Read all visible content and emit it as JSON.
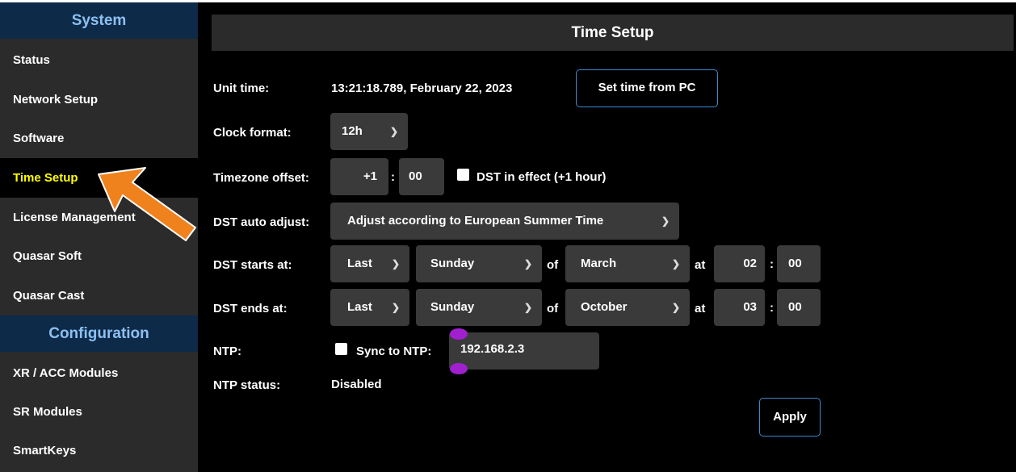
{
  "sidebar": {
    "section_system": "System",
    "section_configuration": "Configuration",
    "items": [
      {
        "label": "Status"
      },
      {
        "label": "Network Setup"
      },
      {
        "label": "Software"
      },
      {
        "label": "Time Setup"
      },
      {
        "label": "License Management"
      },
      {
        "label": "Quasar Soft"
      },
      {
        "label": "Quasar Cast"
      },
      {
        "label": "XR / ACC Modules"
      },
      {
        "label": "SR Modules"
      },
      {
        "label": "SmartKeys"
      }
    ],
    "active_item": "Time Setup"
  },
  "page": {
    "title": "Time Setup"
  },
  "form": {
    "unit_time": {
      "label": "Unit time:",
      "value": "13:21:18.789, February 22, 2023",
      "button": "Set time from PC"
    },
    "clock_format": {
      "label": "Clock format:",
      "value": "12h"
    },
    "timezone": {
      "label": "Timezone offset:",
      "hours": "+1",
      "minutes": "00",
      "dst_checkbox_label": "DST in effect (+1 hour)",
      "dst_checked": false
    },
    "dst_auto": {
      "label": "DST auto adjust:",
      "value": "Adjust according to European Summer Time"
    },
    "dst_start": {
      "label": "DST starts at:",
      "week": "Last",
      "day": "Sunday",
      "of": "of",
      "month": "March",
      "at": "at",
      "hour": "02",
      "minute": "00"
    },
    "dst_end": {
      "label": "DST ends at:",
      "week": "Last",
      "day": "Sunday",
      "of": "of",
      "month": "October",
      "at": "at",
      "hour": "03",
      "minute": "00"
    },
    "ntp": {
      "label": "NTP:",
      "sync_label": "Sync to NTP:",
      "sync_checked": false,
      "server": "192.168.2.3"
    },
    "ntp_status": {
      "label": "NTP status:",
      "value": "Disabled"
    },
    "apply": "Apply"
  },
  "colors": {
    "section_header_bg": "#0e2a49",
    "section_header_text": "#8cc0f0",
    "active_item_text": "#ffff00",
    "button_border": "#3a8ad0",
    "arrow": "#f0821e",
    "handle": "#a020d0"
  },
  "icons": {
    "select_chevron": "chevron-down-icon",
    "annotation": "orange-arrow-icon"
  }
}
